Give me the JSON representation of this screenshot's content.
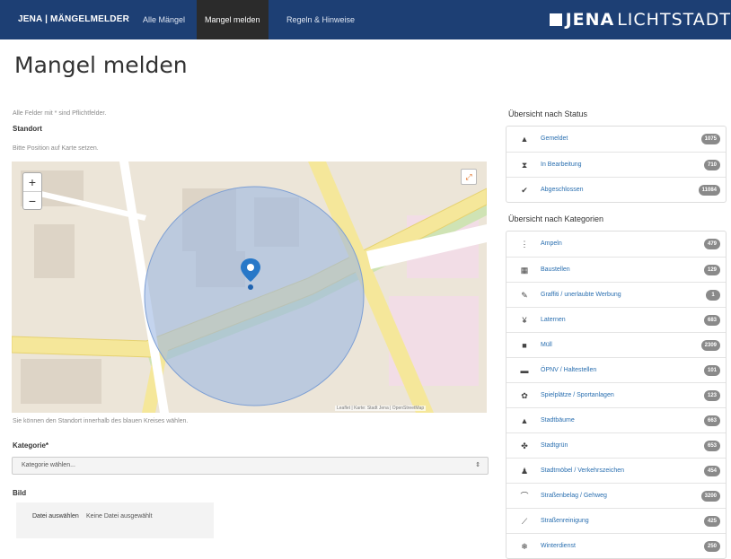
{
  "nav": {
    "brand": "JENA | MÄNGELMELDER",
    "links": [
      "Alle Mängel",
      "Mangel melden",
      "Regeln & Hinweise"
    ],
    "logo_bold": "JENA",
    "logo_light": "LICHTSTADT"
  },
  "page": {
    "title": "Mangel melden"
  },
  "form": {
    "required_note": "Alle Felder mit * sind Pflichtfelder.",
    "location_label": "Standort",
    "location_hint": "Bitte Position auf Karte setzen.",
    "map_attribution": "Leaflet | Karte: Stadt Jena | OpenStreetMap",
    "map_hint": "Sie können den Standort innerhalb des blauen Kreises wählen.",
    "category_label": "Kategorie*",
    "category_placeholder": "Kategorie wählen...",
    "image_label": "Bild",
    "file_button": "Datei auswählen",
    "file_none": "Keine Datei ausgewählt"
  },
  "sidebar": {
    "status_heading": "Übersicht nach Status",
    "status": [
      {
        "icon": "flag-icon",
        "glyph": "▲",
        "label": "Gemeldet",
        "count": "1075"
      },
      {
        "icon": "hourglass-icon",
        "glyph": "⧗",
        "label": "In Bearbeitung",
        "count": "710"
      },
      {
        "icon": "check-icon",
        "glyph": "✔",
        "label": "Abgeschlossen",
        "count": "11084"
      }
    ],
    "category_heading": "Übersicht nach Kategorien",
    "categories": [
      {
        "icon": "traffic-icon",
        "glyph": "⋮",
        "label": "Ampeln",
        "count": "479"
      },
      {
        "icon": "calendar-icon",
        "glyph": "▦",
        "label": "Baustellen",
        "count": "129"
      },
      {
        "icon": "brush-icon",
        "glyph": "✎",
        "label": "Graffiti / unerlaubte Werbung",
        "count": "1"
      },
      {
        "icon": "light-icon",
        "glyph": "¥",
        "label": "Laternen",
        "count": "683"
      },
      {
        "icon": "trash-icon",
        "glyph": "■",
        "label": "Müll",
        "count": "2309"
      },
      {
        "icon": "bus-icon",
        "glyph": "▬",
        "label": "ÖPNV / Haltestellen",
        "count": "101"
      },
      {
        "icon": "gear-icon",
        "glyph": "✿",
        "label": "Spielplätze / Sportanlagen",
        "count": "123"
      },
      {
        "icon": "tree-icon",
        "glyph": "▲",
        "label": "Stadtbäume",
        "count": "663"
      },
      {
        "icon": "leaf-icon",
        "glyph": "✤",
        "label": "Stadtgrün",
        "count": "653"
      },
      {
        "icon": "sign-icon",
        "glyph": "♟",
        "label": "Stadtmöbel / Verkehrszeichen",
        "count": "454"
      },
      {
        "icon": "road-icon",
        "glyph": "⌒",
        "label": "Straßenbelag / Gehweg",
        "count": "3200"
      },
      {
        "icon": "broom-icon",
        "glyph": "⟋",
        "label": "Straßenreinigung",
        "count": "425"
      },
      {
        "icon": "snow-icon",
        "glyph": "❄",
        "label": "Winterdienst",
        "count": "250"
      }
    ]
  }
}
